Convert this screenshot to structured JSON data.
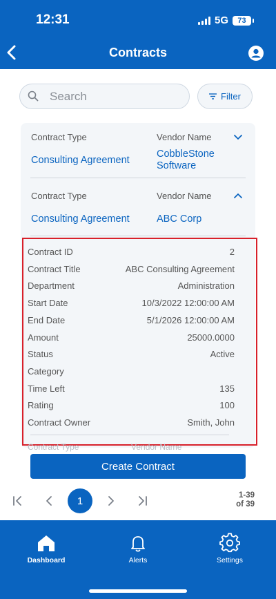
{
  "status_bar": {
    "time": "12:31",
    "network": "5G",
    "battery": "73"
  },
  "header": {
    "title": "Contracts"
  },
  "search": {
    "placeholder": "Search",
    "filter_label": "Filter"
  },
  "contracts": [
    {
      "type_label": "Contract Type",
      "vendor_label": "Vendor Name",
      "type": "Consulting Agreement",
      "vendor": "CobbleStone Software",
      "expanded": false
    },
    {
      "type_label": "Contract Type",
      "vendor_label": "Vendor Name",
      "type": "Consulting Agreement",
      "vendor": "ABC Corp",
      "expanded": true,
      "details": [
        {
          "label": "Contract ID",
          "value": "2"
        },
        {
          "label": "Contract Title",
          "value": "ABC Consulting Agreement"
        },
        {
          "label": "Department",
          "value": "Administration"
        },
        {
          "label": "Start Date",
          "value": "10/3/2022 12:00:00 AM"
        },
        {
          "label": "End Date",
          "value": "5/1/2026 12:00:00 AM"
        },
        {
          "label": "Amount",
          "value": "25000.0000"
        },
        {
          "label": "Status",
          "value": "Active"
        },
        {
          "label": "Category",
          "value": ""
        },
        {
          "label": "Time Left",
          "value": "135"
        },
        {
          "label": "Rating",
          "value": "100"
        },
        {
          "label": "Contract Owner",
          "value": "Smith, John"
        }
      ]
    }
  ],
  "next_card_partial": {
    "type_label": "Contract Type",
    "vendor_label": "Vendor Name"
  },
  "actions": {
    "create_label": "Create Contract"
  },
  "pagination": {
    "current_page": "1",
    "range": "1-39",
    "total": "of 39"
  },
  "bottom_nav": [
    {
      "label": "Dashboard",
      "icon": "home-icon",
      "active": true
    },
    {
      "label": "Alerts",
      "icon": "bell-icon",
      "active": false
    },
    {
      "label": "Settings",
      "icon": "gear-icon",
      "active": false
    }
  ],
  "colors": {
    "brand": "#0a64c0",
    "panel": "#f3f6f9",
    "highlight": "#d8202a"
  }
}
